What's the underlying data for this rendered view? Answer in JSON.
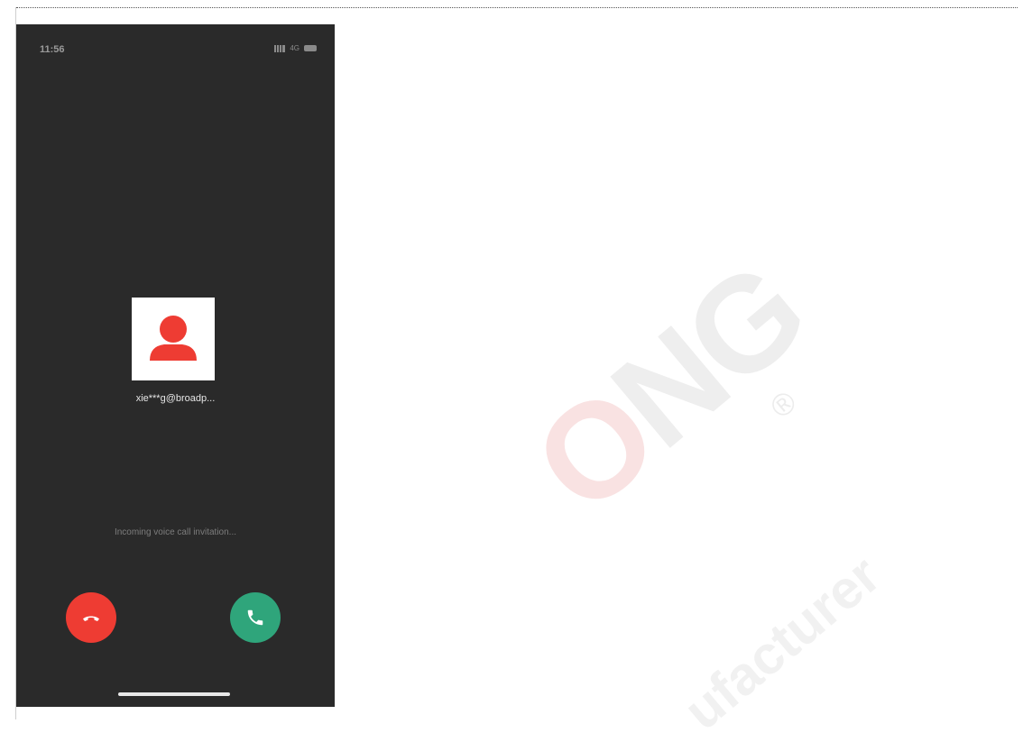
{
  "status_bar": {
    "time": "11:56",
    "network": "4G"
  },
  "caller": {
    "name": "xie***g@broadp...",
    "avatar_icon": "user-icon",
    "avatar_color": "#ee3c33"
  },
  "call": {
    "status_text": "Incoming voice call invitation...",
    "decline_icon": "hang-up-icon",
    "accept_icon": "phone-icon",
    "decline_color": "#ee3c33",
    "accept_color": "#2fa57b"
  }
}
